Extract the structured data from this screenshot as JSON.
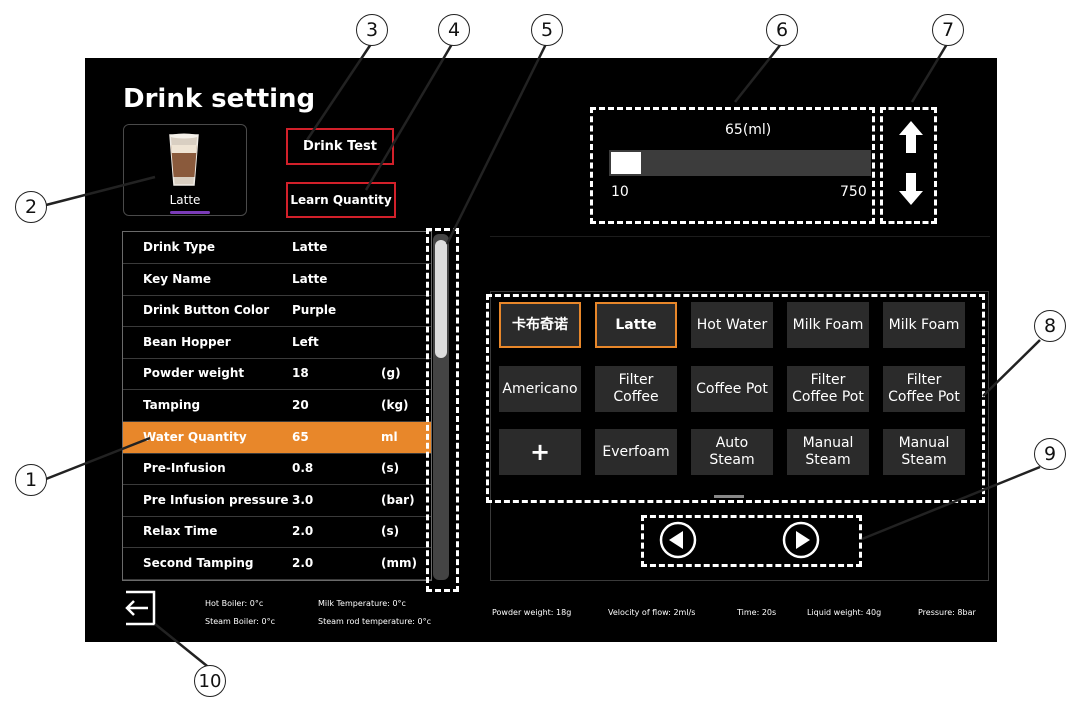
{
  "header": {
    "title": "Drink setting"
  },
  "current_drink": {
    "label": "Latte",
    "icon": "latte-cup-icon"
  },
  "buttons": {
    "drink_test": "Drink Test",
    "learn_quantity": "Learn Quantity"
  },
  "settings": [
    {
      "name": "Drink Type",
      "value": "Latte",
      "unit": ""
    },
    {
      "name": "Key Name",
      "value": "Latte",
      "unit": ""
    },
    {
      "name": "Drink Button Color",
      "value": "Purple",
      "unit": ""
    },
    {
      "name": "Bean Hopper",
      "value": "Left",
      "unit": ""
    },
    {
      "name": "Powder weight",
      "value": "18",
      "unit": "(g)"
    },
    {
      "name": "Tamping",
      "value": "20",
      "unit": "(kg)"
    },
    {
      "name": "Water Quantity",
      "value": "65",
      "unit": "ml"
    },
    {
      "name": "Pre-Infusion",
      "value": "0.8",
      "unit": "(s)"
    },
    {
      "name": "Pre Infusion pressure",
      "value": "3.0",
      "unit": "(bar)"
    },
    {
      "name": "Relax Time",
      "value": "2.0",
      "unit": "(s)"
    },
    {
      "name": "Second Tamping",
      "value": "2.0",
      "unit": "(mm)"
    }
  ],
  "quantity_slider": {
    "value_label": "65(ml)",
    "min_label": "10",
    "max_label": "750",
    "value": 65,
    "min": 10,
    "max": 750
  },
  "adjust": {
    "up_icon": "arrow-up-icon",
    "down_icon": "arrow-down-icon"
  },
  "drinks_grid": [
    "卡布奇诺",
    "Latte",
    "Hot Water",
    "Milk Foam",
    "Milk Foam",
    "Americano",
    "Filter Coffee",
    "Coffee Pot",
    "Filter Coffee Pot",
    "Filter Coffee Pot",
    "+",
    "Everfoam",
    "Auto Steam",
    "Manual Steam",
    "Manual Steam"
  ],
  "pager": {
    "prev_icon": "arrow-left-circle-icon",
    "next_icon": "arrow-right-circle-icon"
  },
  "status_left": {
    "hot_boiler": "Hot Boiler: 0°c",
    "steam_boiler": "Steam Boiler: 0°c",
    "milk_temp": "Milk Temperature: 0°c",
    "steam_rod_temp": "Steam rod temperature: 0°c"
  },
  "status_right": {
    "powder_weight": "Powder weight: 18g",
    "velocity": "Velocity of flow: 2ml/s",
    "time": "Time: 20s",
    "liquid_weight": "Liquid weight: 40g",
    "pressure": "Pressure: 8bar"
  },
  "callouts": [
    "1",
    "2",
    "3",
    "4",
    "5",
    "6",
    "7",
    "8",
    "9",
    "10"
  ],
  "colors": {
    "accent": "#e8872a",
    "alert": "#d2202a",
    "purple": "#7a3bb8",
    "background": "#000000"
  }
}
